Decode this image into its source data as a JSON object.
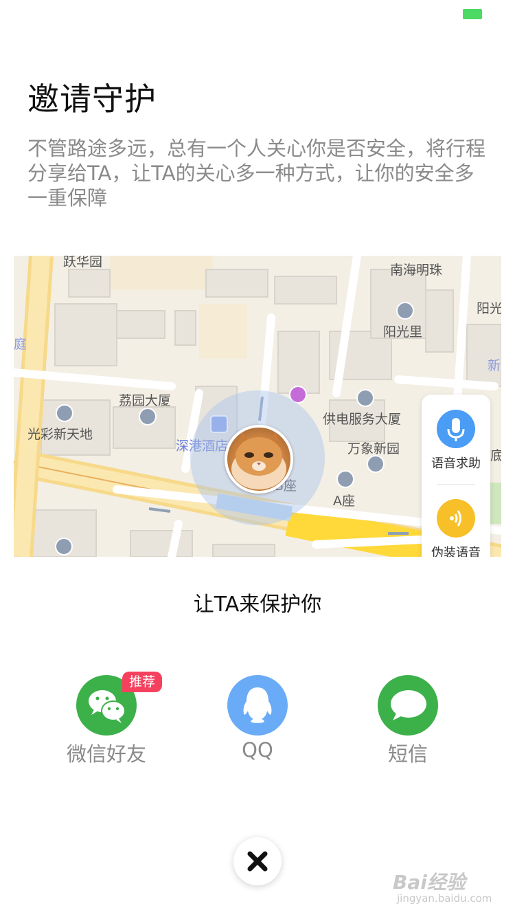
{
  "status_bar": {
    "battery_color": "#4cd964"
  },
  "page": {
    "title": "邀请守护",
    "description": "不管路途多远，总有一个人关心你是否安全，将行程分享给TA，让TA的关心多一种方式，让你的安全多一重保障"
  },
  "map": {
    "labels": {
      "l1": "跃华园",
      "l2": "南海明珠",
      "l3": "阳光",
      "l4": "阳光里",
      "l5": "庭",
      "l6": "新",
      "l7": "荔园大厦",
      "l8": "光彩新天地",
      "l9": "供电服务大厦",
      "l10": "深港酒店",
      "l11": "万象新园",
      "l12": "底",
      "l13": "B座",
      "l14": "A座"
    },
    "side_panel": {
      "voice_help": "语音求助",
      "fake_voice": "伪装语音"
    }
  },
  "share": {
    "subtitle": "让TA来保护你",
    "badge": "推荐",
    "items": [
      {
        "label": "微信好友",
        "color": "#3cb14a",
        "icon": "wechat-icon"
      },
      {
        "label": "QQ",
        "color": "#6aabf7",
        "icon": "qq-penguin-icon"
      },
      {
        "label": "短信",
        "color": "#3cb14a",
        "icon": "sms-bubble-icon"
      }
    ]
  },
  "close": {
    "icon": "close-icon"
  },
  "watermark": {
    "logo": "Bai经验",
    "url": "jingyan.baidu.com"
  }
}
